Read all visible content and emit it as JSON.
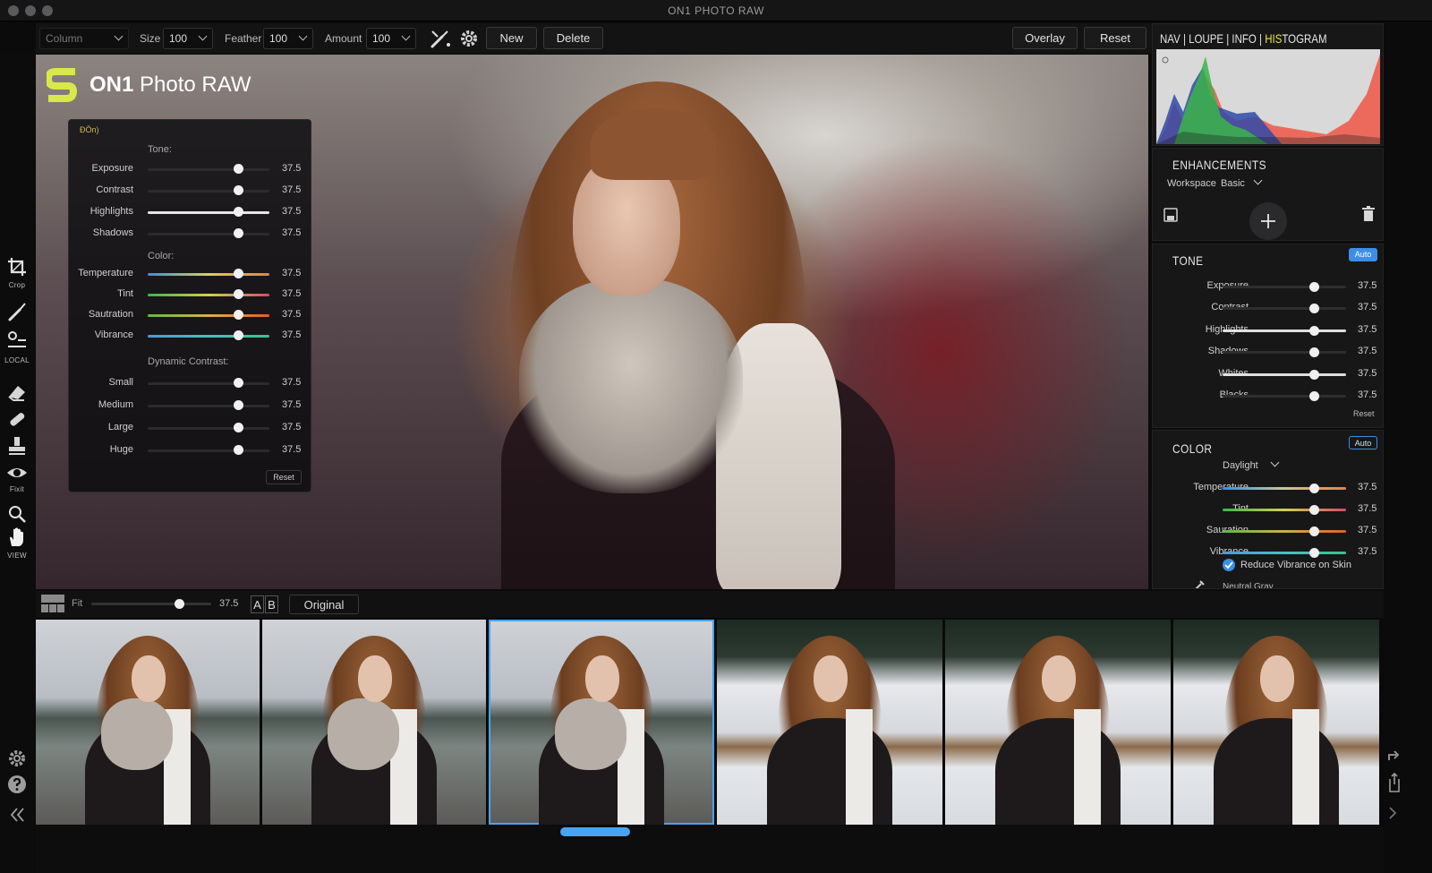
{
  "app": {
    "title": "ON1 PHOTO RAW"
  },
  "toolbar": {
    "column_label": "Column",
    "size_label": "Size",
    "size_value": "100",
    "feather_label": "Feather",
    "feather_value": "100",
    "amount_label": "Amount",
    "amount_value": "100",
    "new_label": "New",
    "delete_label": "Delete",
    "overlay_label": "Overlay",
    "reset_label": "Reset"
  },
  "left_tools": [
    {
      "icon": "crop-icon",
      "label": "Crop"
    },
    {
      "icon": "brush-icon",
      "label": ""
    },
    {
      "icon": "local-icon",
      "label": "LOCAL"
    },
    {
      "icon": "eraser-icon",
      "label": ""
    },
    {
      "icon": "heal-icon",
      "label": ""
    },
    {
      "icon": "stamp-icon",
      "label": ""
    },
    {
      "icon": "eye-icon",
      "label": "Fixit"
    },
    {
      "icon": "zoom-icon",
      "label": ""
    },
    {
      "icon": "hand-icon",
      "label": "VIEW"
    }
  ],
  "logo": {
    "brand": "ON1",
    "product": "Photo RAW"
  },
  "tone_float": {
    "header": "ĐÖn)",
    "tone_heading": "Tone:",
    "tone_rows": [
      {
        "label": "Exposure",
        "value": "37.5",
        "pos": 0.74
      },
      {
        "label": "Contrast",
        "value": "37.5",
        "pos": 0.74
      },
      {
        "label": "Highlights",
        "value": "37.5",
        "pos": 0.74
      },
      {
        "label": "Shadows",
        "value": "37.5",
        "pos": 0.74
      }
    ],
    "color_heading": "Color:",
    "color_rows": [
      {
        "label": "Temperature",
        "value": "37.5",
        "pos": 0.74
      },
      {
        "label": "Tint",
        "value": "37.5",
        "pos": 0.74
      },
      {
        "label": "Sautration",
        "value": "37.5",
        "pos": 0.74
      },
      {
        "label": "Vibrance",
        "value": "37.5",
        "pos": 0.74
      }
    ],
    "dynamic_heading": "Dynamic Contrast:",
    "dynamic_rows": [
      {
        "label": "Small",
        "value": "37.5",
        "pos": 0.74
      },
      {
        "label": "Medium",
        "value": "37.5",
        "pos": 0.74
      },
      {
        "label": "Large",
        "value": "37.5",
        "pos": 0.74
      },
      {
        "label": "Huge",
        "value": "37.5",
        "pos": 0.74
      }
    ],
    "reset_label": "Reset"
  },
  "right": {
    "tabs": {
      "nav": "NAV",
      "loupe": "LOUPE",
      "info": "INFO",
      "histogram_a": "HIS",
      "histogram_b": "TOGRAM"
    },
    "enhancements": {
      "title": "ENHANCEMENTS",
      "workspace_label": "Workspace",
      "workspace_value": "Basic"
    },
    "tone": {
      "title": "TONE",
      "auto_label": "Auto",
      "rows": [
        {
          "label": "Exposure",
          "value": "37.5",
          "pos": 0.74
        },
        {
          "label": "Contrast",
          "value": "37.5",
          "pos": 0.74
        },
        {
          "label": "Highlights",
          "value": "37.5",
          "pos": 0.74
        },
        {
          "label": "Shadows",
          "value": "37.5",
          "pos": 0.74
        },
        {
          "label": "Whites",
          "value": "37.5",
          "pos": 0.74
        },
        {
          "label": "Blacks",
          "value": "37.5",
          "pos": 0.74
        }
      ],
      "reset_label": "Reset"
    },
    "color": {
      "title": "COLOR",
      "auto_label": "Auto",
      "preset": "Daylight",
      "rows": [
        {
          "label": "Temperature",
          "value": "37.5",
          "pos": 0.74
        },
        {
          "label": "Tint",
          "value": "37.5",
          "pos": 0.74
        },
        {
          "label": "Sauration",
          "value": "37.5",
          "pos": 0.74
        },
        {
          "label": "Vibrance",
          "value": "37.5",
          "pos": 0.74
        }
      ],
      "reduce_vibrance_label": "Reduce Vibrance on Skin",
      "neutral_gray_label": "Neutral Gray"
    }
  },
  "filmbar": {
    "fit_label": "Fit",
    "zoom_value": "37.5",
    "zoom_pos": 0.73,
    "a_label": "A",
    "b_label": "B",
    "original_label": "Original"
  },
  "thumbnails": [
    "winter",
    "winter",
    "winter-selected",
    "snow",
    "snow",
    "snow"
  ],
  "colors": {
    "accent": "#4aa3f0",
    "logo": "#d9e84a",
    "bg": "#0b0b0c"
  }
}
